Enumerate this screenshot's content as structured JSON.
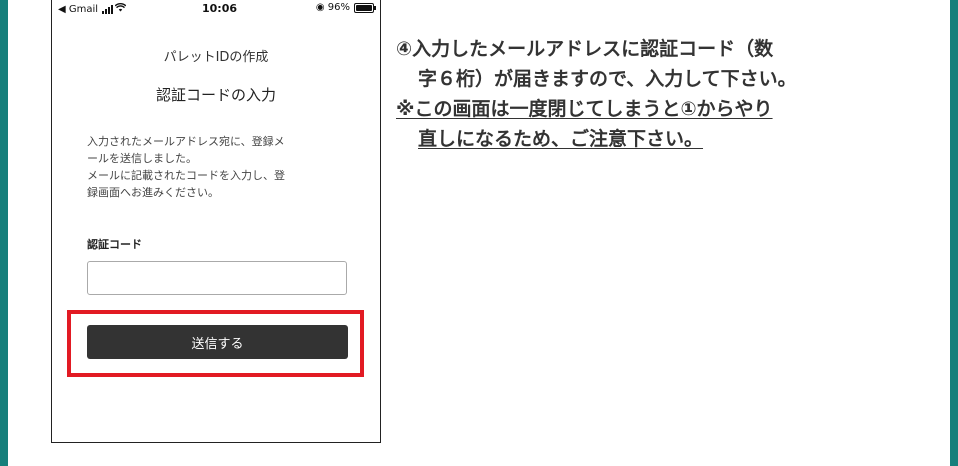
{
  "status_bar": {
    "carrier": "◀ Gmail",
    "time": "10:06",
    "battery_text": "◉ 96%"
  },
  "screen": {
    "subtitle": "パレットIDの作成",
    "title": "認証コードの入力",
    "instructions": [
      "入力されたメールアドレス宛に、登録メ",
      "ールを送信しました。",
      "メールに記載されたコードを入力し、登",
      "録画面へお進みください。"
    ],
    "field_label": "認証コード",
    "code_value": "",
    "send_label": "送信する"
  },
  "step": {
    "line1": "④入力したメールアドレスに認証コード（数",
    "line2": "字６桁）が届きますので、入力して下さい。",
    "note_line1": "※この画面は一度閉じてしまうと①からやり",
    "note_line2": "直しになるため、ご注意下さい。"
  },
  "colors": {
    "frame": "#167f7b",
    "highlight": "#e21a23",
    "button": "#333333"
  }
}
